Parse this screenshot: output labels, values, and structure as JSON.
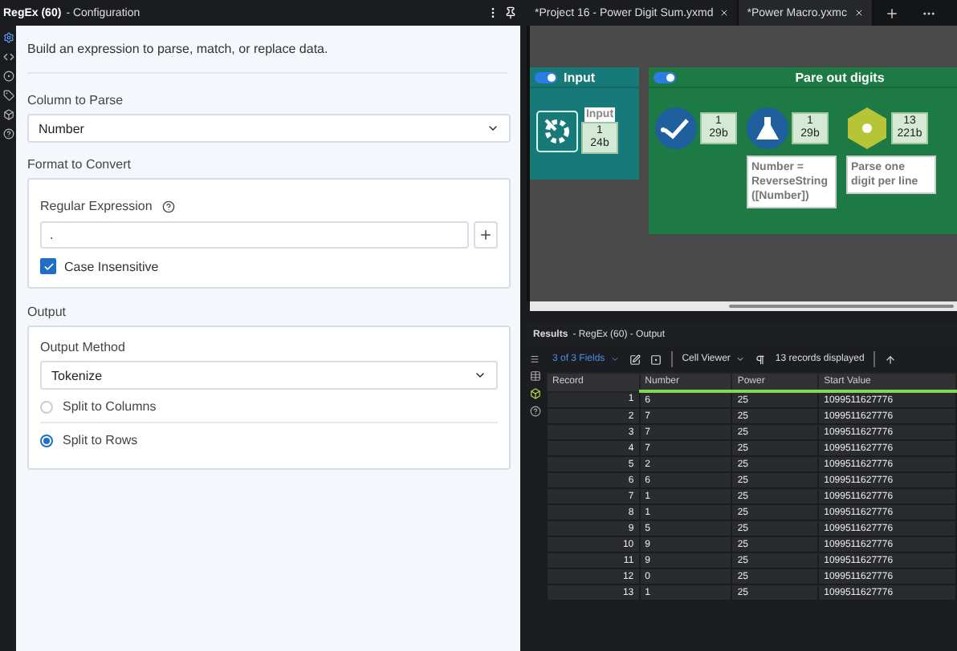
{
  "config": {
    "title": "RegEx (60)",
    "subtitle": "- Configuration",
    "description": "Build an expression to parse, match, or replace data.",
    "column_to_parse": {
      "label": "Column to Parse",
      "value": "Number"
    },
    "format": {
      "heading": "Format to Convert",
      "regex_label": "Regular Expression",
      "regex_value": ".",
      "case_insensitive": {
        "label": "Case Insensitive",
        "checked": true
      }
    },
    "output": {
      "heading": "Output",
      "method_label": "Output Method",
      "method_value": "Tokenize",
      "options": [
        {
          "label": "Split to Columns",
          "selected": false
        },
        {
          "label": "Split to Rows",
          "selected": true
        }
      ]
    }
  },
  "tabs": [
    {
      "label": "*Project 16 - Power Digit Sum.yxmd",
      "selected": false
    },
    {
      "label": "*Power Macro.yxmc",
      "selected": true
    }
  ],
  "canvas": {
    "containers": [
      {
        "title": "Input",
        "enabled": true,
        "color": "#177a78",
        "tools": [
          {
            "kind": "input",
            "label": "Input",
            "counts": [
              "1",
              "24b"
            ]
          }
        ]
      },
      {
        "title": "Pare out digits",
        "enabled": true,
        "color": "#1d7a44",
        "tools": [
          {
            "kind": "select",
            "counts": [
              "1",
              "29b"
            ]
          },
          {
            "kind": "formula",
            "annotation": "Number = ReverseString ([Number])",
            "counts": [
              "1",
              "29b"
            ]
          },
          {
            "kind": "regex",
            "annotation": "Parse one digit per line",
            "counts": [
              "13",
              "221b"
            ]
          }
        ]
      }
    ]
  },
  "results": {
    "title": "Results",
    "subtitle": "- RegEx (60) - Output",
    "fields": "3 of 3 Fields",
    "viewer": "Cell Viewer",
    "records": "13 records displayed",
    "columns": [
      "Record",
      "Number",
      "Power",
      "Start Value"
    ],
    "rows": [
      [
        "1",
        "6",
        "25",
        "1099511627776"
      ],
      [
        "2",
        "7",
        "25",
        "1099511627776"
      ],
      [
        "3",
        "7",
        "25",
        "1099511627776"
      ],
      [
        "4",
        "7",
        "25",
        "1099511627776"
      ],
      [
        "5",
        "2",
        "25",
        "1099511627776"
      ],
      [
        "6",
        "6",
        "25",
        "1099511627776"
      ],
      [
        "7",
        "1",
        "25",
        "1099511627776"
      ],
      [
        "8",
        "1",
        "25",
        "1099511627776"
      ],
      [
        "9",
        "5",
        "25",
        "1099511627776"
      ],
      [
        "10",
        "9",
        "25",
        "1099511627776"
      ],
      [
        "11",
        "9",
        "25",
        "1099511627776"
      ],
      [
        "12",
        "0",
        "25",
        "1099511627776"
      ],
      [
        "13",
        "1",
        "25",
        "1099511627776"
      ]
    ]
  }
}
